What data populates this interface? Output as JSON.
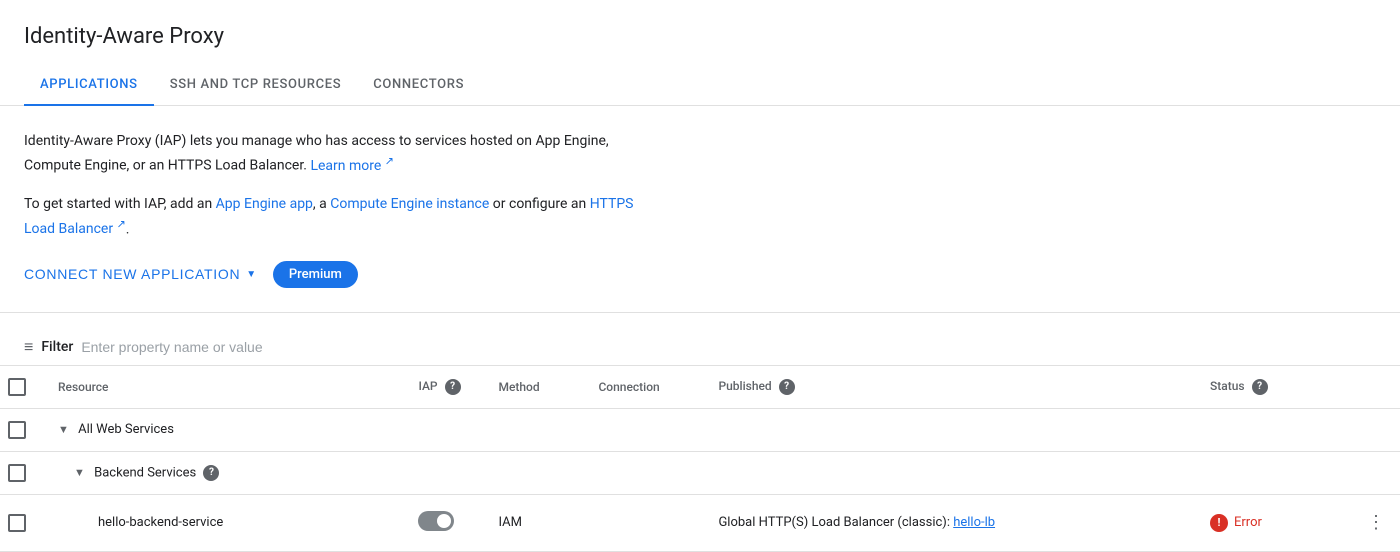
{
  "page": {
    "title": "Identity-Aware Proxy"
  },
  "tabs": [
    {
      "id": "applications",
      "label": "APPLICATIONS",
      "active": true
    },
    {
      "id": "ssh-tcp",
      "label": "SSH AND TCP RESOURCES",
      "active": false
    },
    {
      "id": "connectors",
      "label": "CONNECTORS",
      "active": false
    }
  ],
  "description": {
    "line1": "Identity-Aware Proxy (IAP) lets you manage who has access to services hosted on App Engine, Compute Engine, or an HTTPS Load Balancer.",
    "learn_more_text": "Learn more",
    "line2_prefix": "To get started with IAP, add an",
    "app_engine_link": "App Engine app",
    "line2_mid": ", a",
    "compute_engine_link": "Compute Engine instance",
    "line2_suffix": "or configure an",
    "https_lb_link": "HTTPS Load Balancer",
    "line2_end": "."
  },
  "actions": {
    "connect_new_label": "CONNECT NEW APPLICATION",
    "premium_label": "Premium"
  },
  "filter": {
    "label": "Filter",
    "placeholder": "Enter property name or value"
  },
  "table": {
    "columns": [
      {
        "id": "checkbox",
        "label": ""
      },
      {
        "id": "resource",
        "label": "Resource"
      },
      {
        "id": "iap",
        "label": "IAP",
        "help": true
      },
      {
        "id": "method",
        "label": "Method"
      },
      {
        "id": "connection",
        "label": "Connection"
      },
      {
        "id": "published",
        "label": "Published",
        "help": true
      },
      {
        "id": "status",
        "label": "Status",
        "help": true
      },
      {
        "id": "actions",
        "label": ""
      }
    ],
    "rows": [
      {
        "type": "group",
        "indent": 0,
        "resource": "All Web Services",
        "expanded": true
      },
      {
        "type": "group",
        "indent": 1,
        "resource": "Backend Services",
        "expanded": true,
        "help": true
      },
      {
        "type": "item",
        "indent": 2,
        "resource": "hello-backend-service",
        "iap_enabled": false,
        "method": "IAM",
        "connection": "",
        "published": "Global HTTP(S) Load Balancer (classic): hello-lb",
        "published_link": "hello-lb",
        "status": "Error",
        "has_error": true
      }
    ]
  }
}
